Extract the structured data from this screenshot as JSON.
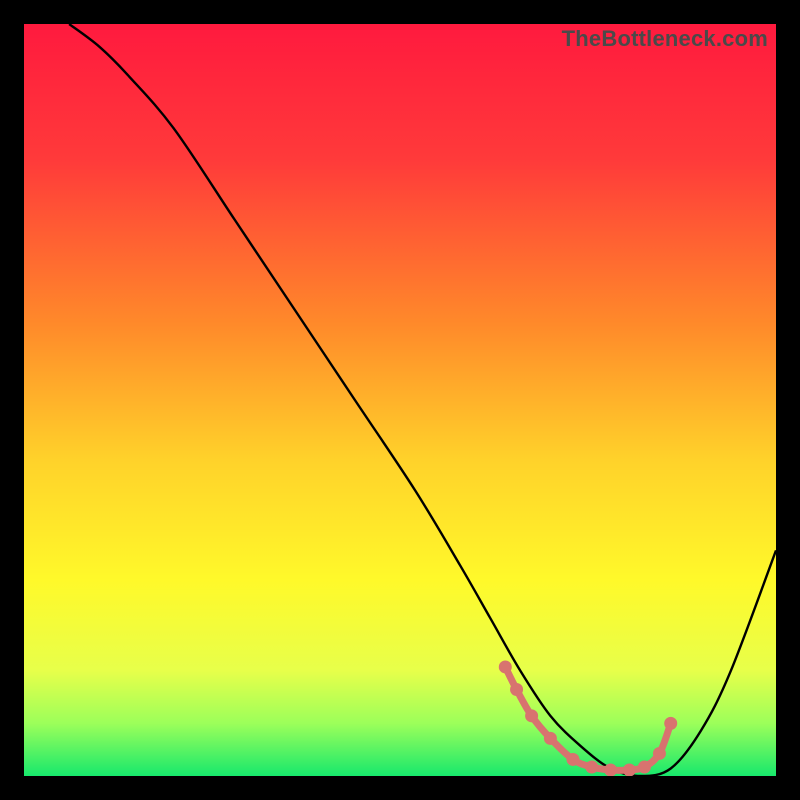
{
  "watermark": "TheBottleneck.com",
  "chart_data": {
    "type": "line",
    "title": "",
    "xlabel": "",
    "ylabel": "",
    "xlim": [
      0,
      100
    ],
    "ylim": [
      0,
      100
    ],
    "grid": false,
    "legend": false,
    "gradient_stops": [
      {
        "offset": 0,
        "color": "#ff1a3e"
      },
      {
        "offset": 18,
        "color": "#ff3a3a"
      },
      {
        "offset": 40,
        "color": "#ff8a2a"
      },
      {
        "offset": 58,
        "color": "#ffd22a"
      },
      {
        "offset": 74,
        "color": "#fff92a"
      },
      {
        "offset": 86,
        "color": "#e7ff4a"
      },
      {
        "offset": 93,
        "color": "#9cff5a"
      },
      {
        "offset": 100,
        "color": "#17e86c"
      }
    ],
    "series": [
      {
        "name": "bottleneck-curve",
        "color": "#000000",
        "x": [
          6,
          10,
          14,
          20,
          28,
          36,
          44,
          52,
          58,
          62,
          66,
          70,
          74,
          78,
          82,
          86,
          90,
          94,
          100
        ],
        "y": [
          100,
          97,
          93,
          86,
          74,
          62,
          50,
          38,
          28,
          21,
          14,
          8,
          4,
          1,
          0,
          1,
          6,
          14,
          30
        ]
      }
    ],
    "highlight_points": {
      "name": "optimal-range",
      "color": "#d8736f",
      "x": [
        64.0,
        65.5,
        67.5,
        70.0,
        73.0,
        75.5,
        78.0,
        80.5,
        82.5,
        84.5,
        86.0
      ],
      "y": [
        14.5,
        11.5,
        8.0,
        5.0,
        2.2,
        1.2,
        0.8,
        0.8,
        1.2,
        3.0,
        7.0
      ]
    }
  }
}
